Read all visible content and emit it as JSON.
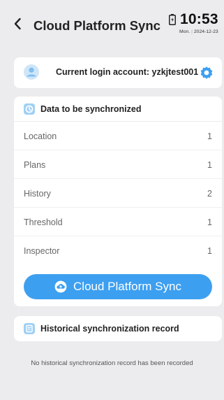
{
  "header": {
    "title": "Cloud Platform Sync",
    "back_icon": "chevron-left-icon"
  },
  "status": {
    "time": "10:53",
    "weekday": "Mon.",
    "date": "2024-12-23",
    "battery_icon": "battery-icon"
  },
  "account": {
    "label": "Current login account: yzkjtest001",
    "avatar_icon": "user-avatar-icon",
    "settings_icon": "gear-icon"
  },
  "sync_section": {
    "title": "Data to be synchronized",
    "icon": "clock-icon",
    "rows": [
      {
        "label": "Location",
        "count": "1"
      },
      {
        "label": "Plans",
        "count": "1"
      },
      {
        "label": "History",
        "count": "2"
      },
      {
        "label": "Threshold",
        "count": "1"
      },
      {
        "label": "Inspector",
        "count": "1"
      }
    ],
    "button_label": "Cloud Platform Sync",
    "button_icon": "cloud-upload-icon"
  },
  "history_section": {
    "title": "Historical synchronization record",
    "icon": "record-icon",
    "empty_text": "No historical synchronization record has been recorded"
  },
  "colors": {
    "accent": "#3d9ff0",
    "icon_light": "#9fd0f5",
    "background": "#ececee",
    "card": "#ffffff"
  }
}
